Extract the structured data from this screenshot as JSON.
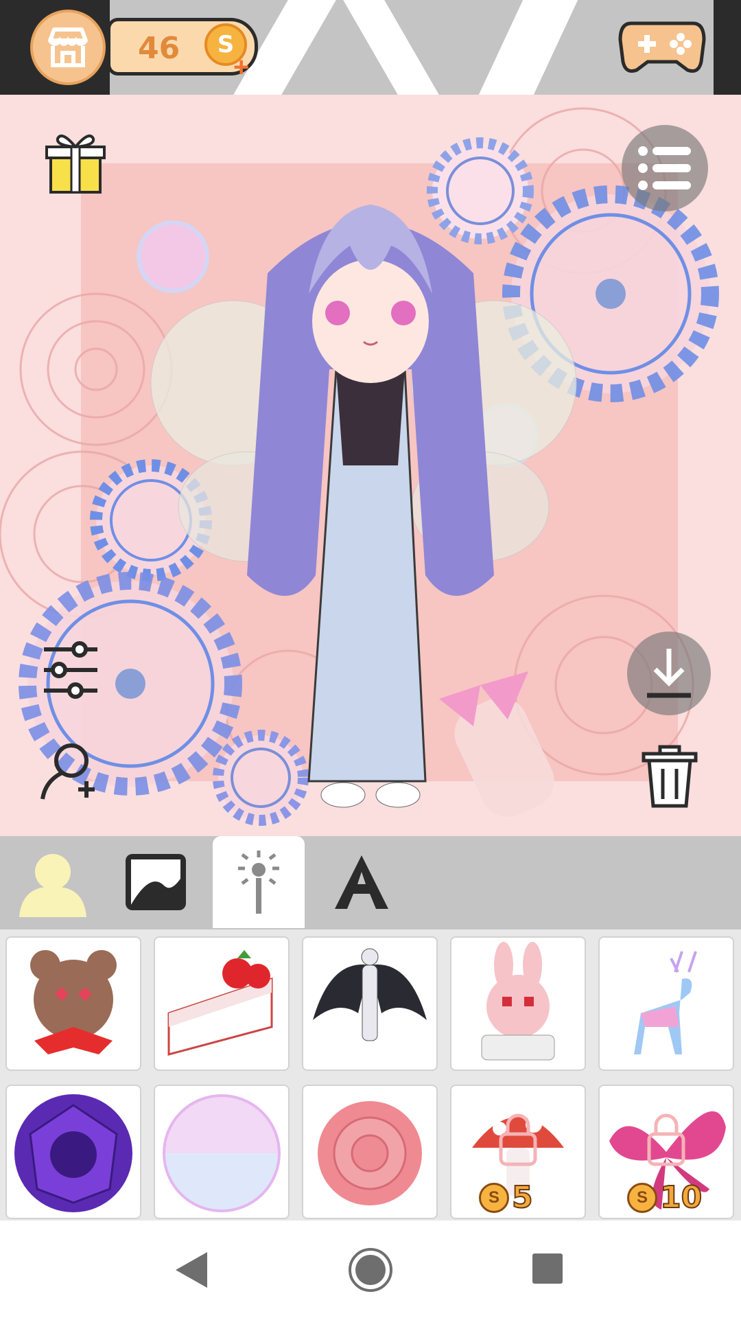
{
  "header": {
    "coins": "46",
    "coin_symbol": "S",
    "add_coins_symbol": "+"
  },
  "tabs": [
    {
      "name": "character",
      "icon": "person-icon",
      "active": false
    },
    {
      "name": "background",
      "icon": "image-icon",
      "active": false
    },
    {
      "name": "effects",
      "icon": "magic-wand-icon",
      "active": true
    },
    {
      "name": "text",
      "icon": "letter-a-icon",
      "active": false
    }
  ],
  "items": [
    {
      "name": "heart-eyes-bear",
      "locked": false
    },
    {
      "name": "strawberry-cake",
      "locked": false
    },
    {
      "name": "dark-angel-wings",
      "locked": false
    },
    {
      "name": "pink-rabbit",
      "locked": false
    },
    {
      "name": "galaxy-deer",
      "locked": false
    },
    {
      "name": "purple-gem",
      "locked": false
    },
    {
      "name": "bubble-orb",
      "locked": false
    },
    {
      "name": "pink-rose",
      "locked": false
    },
    {
      "name": "mushroom",
      "locked": true,
      "price": "5"
    },
    {
      "name": "butterfly",
      "locked": true,
      "price": "10"
    }
  ],
  "colors": {
    "accent_orange": "#f7b340",
    "canvas_bg": "#fbdede",
    "toolbar_gray": "#c4c4c4"
  }
}
